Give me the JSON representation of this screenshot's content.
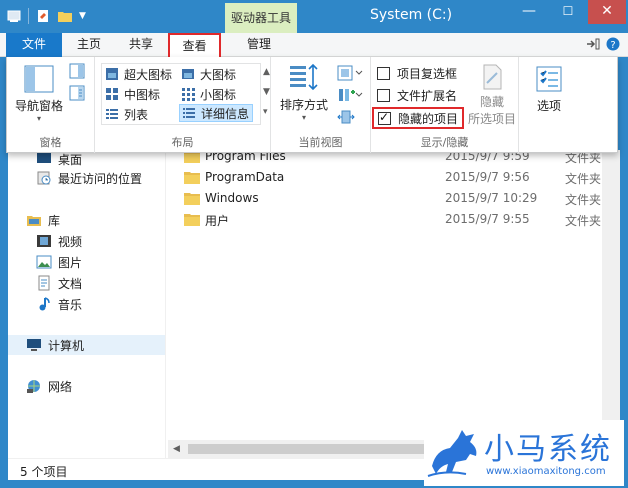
{
  "window": {
    "title": "System (C:)",
    "context_tab": "驱动器工具",
    "controls": {
      "minimize": "—",
      "maximize": "☐",
      "close": "✕"
    }
  },
  "tabs": {
    "file": "文件",
    "home": "主页",
    "share": "共享",
    "view": "查看",
    "manage": "管理"
  },
  "ribbon": {
    "panes": {
      "nav_pane": "导航窗格",
      "label": "窗格"
    },
    "layout": {
      "extra_large": "超大图标",
      "large": "大图标",
      "medium": "中图标",
      "small": "小图标",
      "list": "列表",
      "details": "详细信息",
      "label": "布局"
    },
    "current_view": {
      "sort_by": "排序方式",
      "label": "当前视图"
    },
    "show_hide": {
      "item_checkboxes": "项目复选框",
      "file_extensions": "文件扩展名",
      "hidden_items": "隐藏的项目",
      "hide_selected_l1": "隐藏",
      "hide_selected_l2": "所选项目",
      "label": "显示/隐藏"
    },
    "options": "选项"
  },
  "nav": {
    "desktop": "桌面",
    "recent": "最近访问的位置",
    "libraries": "库",
    "videos": "视频",
    "pictures": "图片",
    "documents": "文档",
    "music": "音乐",
    "computer": "计算机",
    "network": "网络"
  },
  "files": [
    {
      "name": "Program Files",
      "date": "2015/9/7 9:59",
      "type": "文件夹"
    },
    {
      "name": "ProgramData",
      "date": "2015/9/7 9:56",
      "type": "文件夹"
    },
    {
      "name": "Windows",
      "date": "2015/9/7 10:29",
      "type": "文件夹"
    },
    {
      "name": "用户",
      "date": "2015/9/7 9:55",
      "type": "文件夹"
    }
  ],
  "status": {
    "item_count": "5 个项目"
  },
  "watermark": {
    "title": "小马系统",
    "url": "www.xiaomaxitong.com"
  },
  "colors": {
    "titlebar": "#2f87c8",
    "file_tab": "#1979ca",
    "context_tab": "#dbeec0",
    "highlight": "#e0292b",
    "close": "#c7504e",
    "folder": "#e8bd4f",
    "watermark": "#2a74d8"
  }
}
